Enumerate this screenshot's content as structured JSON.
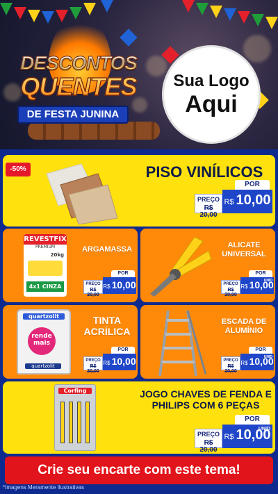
{
  "hero": {
    "title_line1": "DESCONTOS",
    "title_line2": "QUENTES",
    "subtitle": "DE FESTA JUNINA",
    "logo_line1": "Sua Logo",
    "logo_line2": "Aqui"
  },
  "products": [
    {
      "name": "PISO VINÍLICOS",
      "discount": "-50%",
      "price_label": "PREÇO",
      "old_price": "R$ 20,00",
      "tag": "POR",
      "currency": "R$",
      "value": "10,00",
      "unit": ""
    },
    {
      "name": "ARGAMASSA",
      "price_label": "PREÇO",
      "old_price": "R$ 20,00",
      "tag": "POR",
      "currency": "R$",
      "value": "10,00",
      "unit": ""
    },
    {
      "name": "ALICATE UNIVERSAL",
      "price_label": "PREÇO",
      "old_price": "R$ 20,00",
      "tag": "POR",
      "currency": "R$",
      "value": "10,00",
      "unit": "UNID"
    },
    {
      "name": "TINTA ACRÍLICA",
      "price_label": "PREÇO",
      "old_price": "R$ 20,00",
      "tag": "POR",
      "currency": "R$",
      "value": "10,00",
      "unit": ""
    },
    {
      "name": "ESCADA DE ALUMÍNIO",
      "price_label": "PREÇO",
      "old_price": "R$ 20,00",
      "tag": "POR",
      "currency": "R$",
      "value": "10,00",
      "unit": "UNID"
    },
    {
      "name": "JOGO CHAVES DE FENDA E PHILIPS COM 6 PEÇAS",
      "price_label": "PREÇO",
      "old_price": "R$ 20,00",
      "tag": "POR",
      "currency": "R$",
      "value": "10,00",
      "unit": "UNID"
    }
  ],
  "product_images": {
    "argamassa_brand": "REVESTFIX",
    "argamassa_sub": "PREMIUM",
    "argamassa_weight": "20kg",
    "argamassa_type": "4x1 CINZA",
    "tinta_brand": "quartzolit",
    "tinta_line1": "rende",
    "tinta_line2": "mais",
    "chaves_brand": "Corfing"
  },
  "footer": {
    "cta": "Crie seu encarte com este tema!",
    "disclaimer": "*Imagens Meramente Ilustrativas"
  },
  "colors": {
    "blue_bg": "#0e2a8f",
    "yellow": "#ffe10d",
    "orange": "#ff8a0a",
    "price_blue": "#1f46c9",
    "cta_red": "#e2141b"
  }
}
